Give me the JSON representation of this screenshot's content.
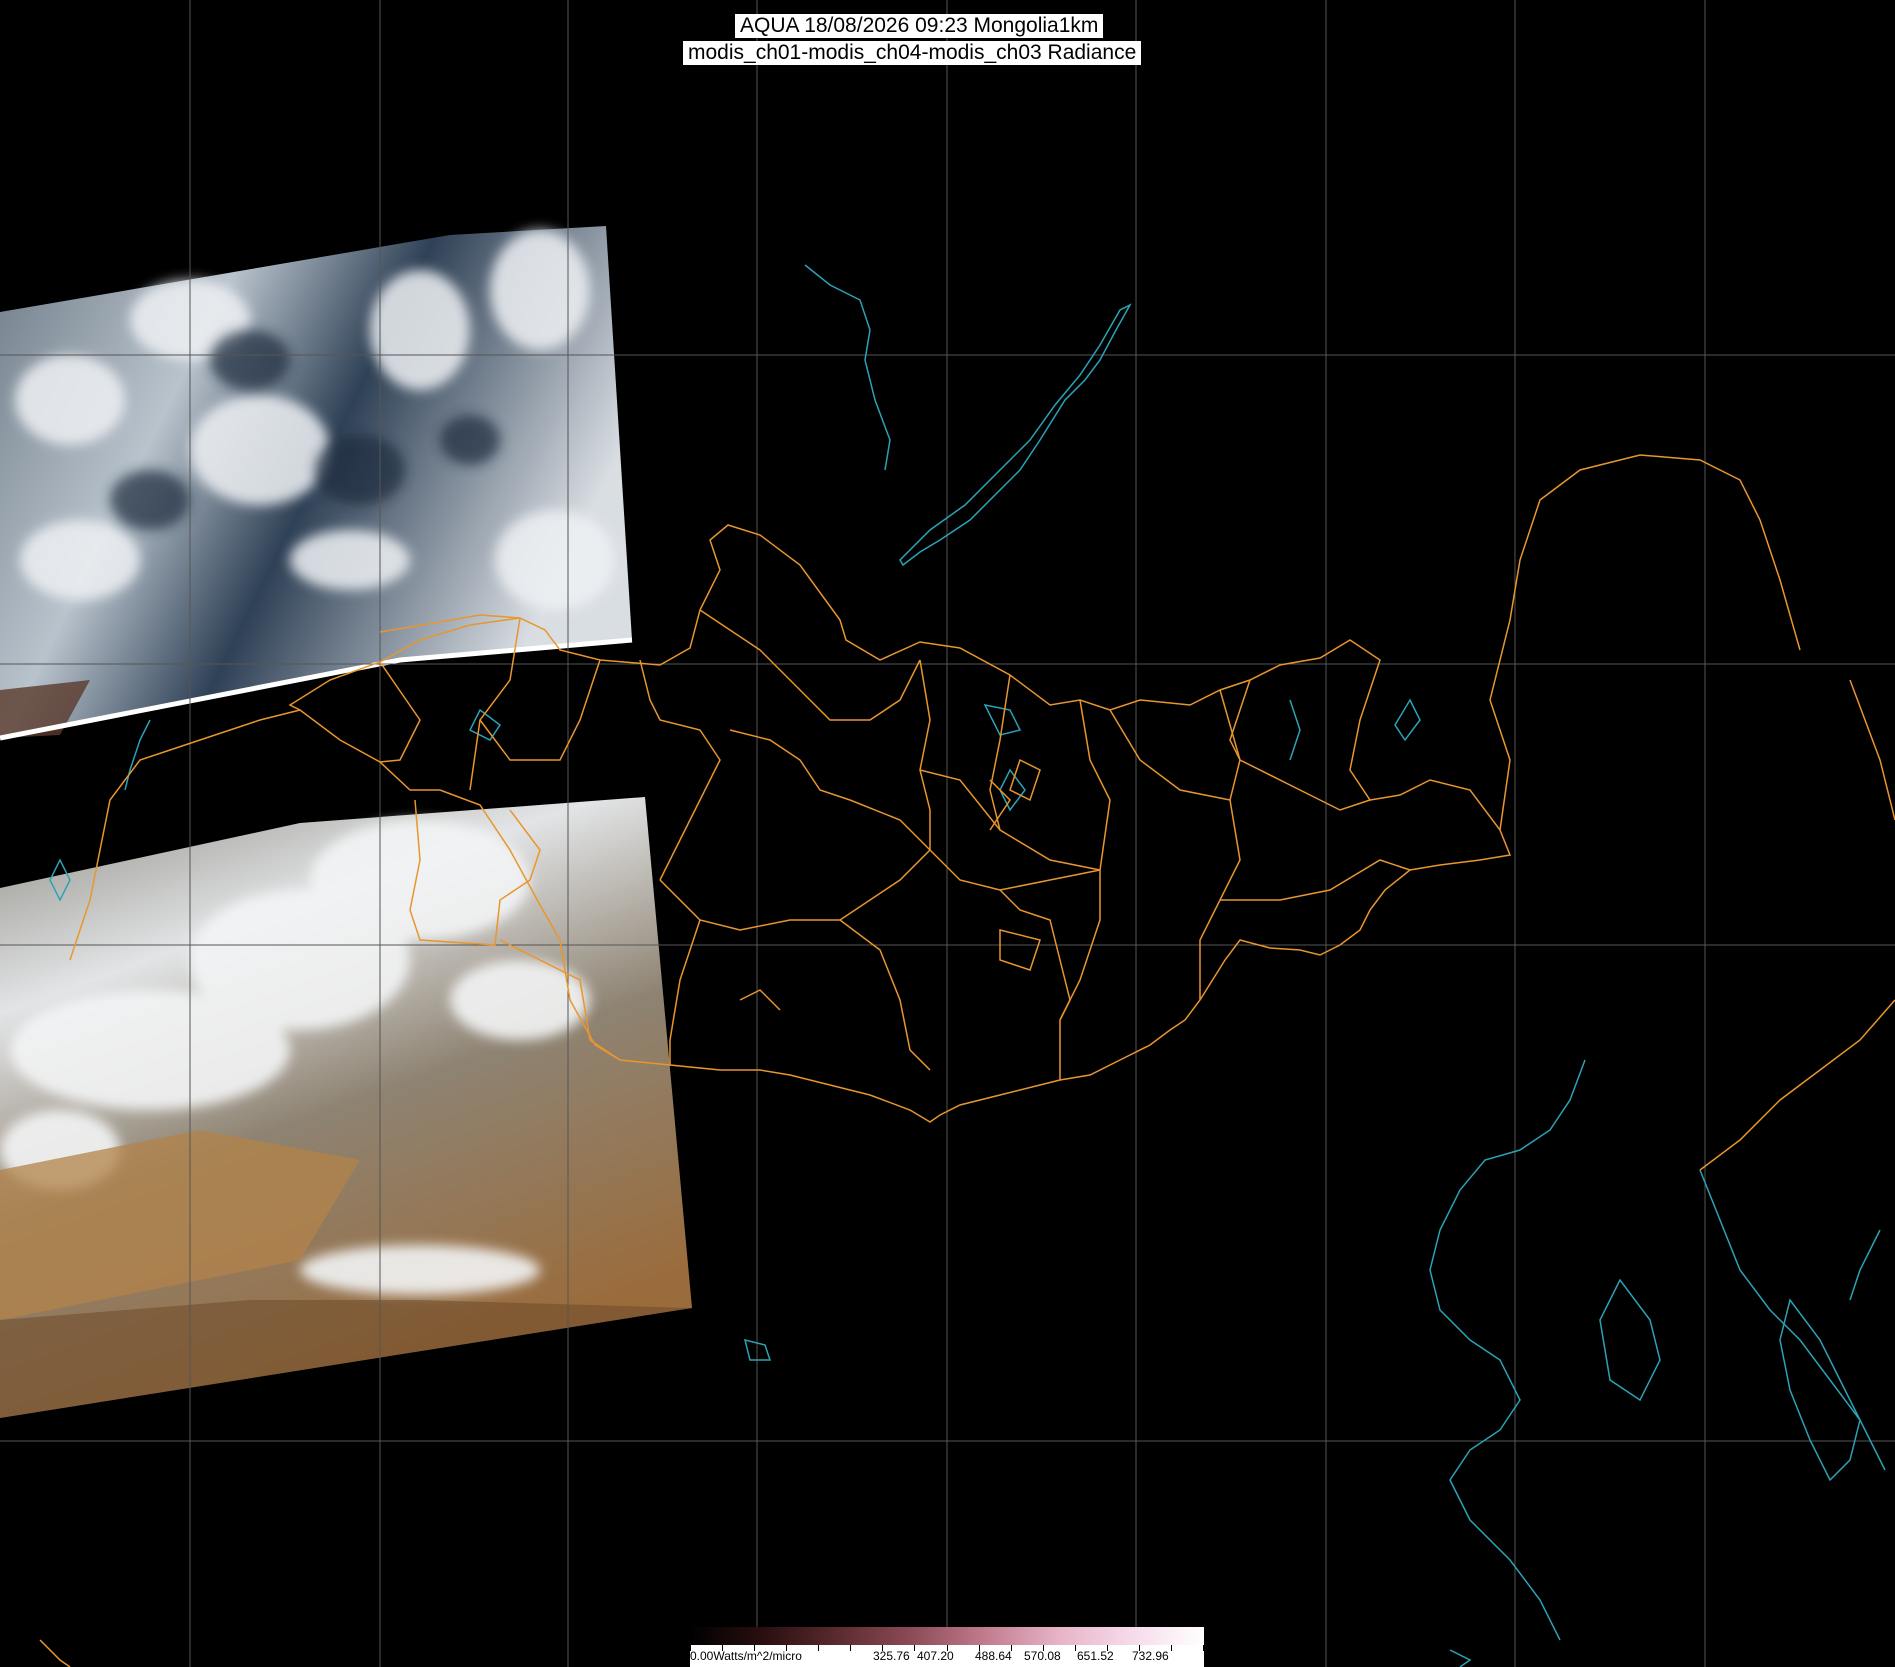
{
  "title": {
    "line1": "AQUA 18/08/2026 09:23 Mongolia1km",
    "line2": "modis_ch01-modis_ch04-modis_ch03 Radiance"
  },
  "colorbar": {
    "min_label": "0.00Watts/m^2/micro",
    "tick_labels": [
      "325.76",
      "407.20",
      "488.64",
      "570.08",
      "651.52",
      "732.96"
    ],
    "colors": [
      "#000000",
      "#2a0f10",
      "#5a2a2e",
      "#8c4a56",
      "#c07a8c",
      "#e6b2c6",
      "#f6daea",
      "#ffffff"
    ]
  },
  "map": {
    "graticule_color": "#555555",
    "border_color": "#e8962e",
    "coast_color": "#2ba3b6",
    "background_color": "#000000"
  }
}
